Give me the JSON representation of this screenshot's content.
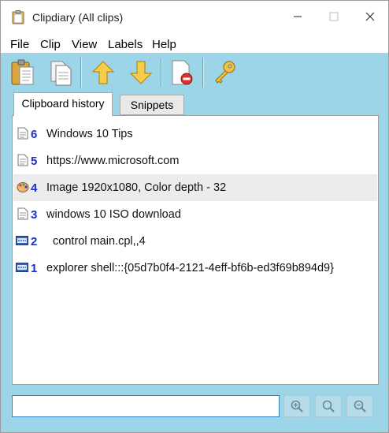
{
  "window": {
    "title": "Clipdiary (All clips)",
    "minimize_icon": "minimize-icon",
    "maximize_icon": "maximize-icon",
    "close_icon": "close-icon"
  },
  "menu": [
    "File",
    "Clip",
    "View",
    "Labels",
    "Help"
  ],
  "toolbar": {
    "icons": [
      "clipboard-paste-icon",
      "copy-pages-icon",
      "arrow-up-icon",
      "arrow-down-icon",
      "delete-document-icon",
      "key-icon"
    ]
  },
  "tabs": {
    "history": "Clipboard history",
    "snippets": "Snippets",
    "active": "history"
  },
  "clips": [
    {
      "num": "6",
      "text": "Windows 10 Tips",
      "icon": "text-document-icon"
    },
    {
      "num": "5",
      "text": "https://www.microsoft.com",
      "icon": "text-document-icon"
    },
    {
      "num": "4",
      "text": "Image 1920x1080, Color depth - 32",
      "icon": "image-palette-icon",
      "selected": true
    },
    {
      "num": "3",
      "text": "windows 10 ISO download",
      "icon": "text-document-icon"
    },
    {
      "num": "2",
      "text": "  control main.cpl,,4",
      "icon": "html-icon"
    },
    {
      "num": "1",
      "text": "explorer shell:::{05d7b0f4-2121-4eff-bf6b-ed3f69b894d9}",
      "icon": "html-icon"
    }
  ],
  "search": {
    "value": "",
    "placeholder": "",
    "buttons": [
      "zoom-in-icon",
      "search-icon",
      "zoom-out-icon"
    ]
  },
  "colors": {
    "accent_bg": "#9dd5e8",
    "number_blue": "#1a2fcc",
    "selected_row": "#ececec"
  }
}
